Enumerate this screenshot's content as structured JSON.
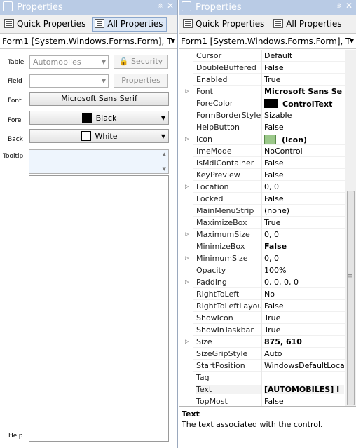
{
  "left_panel": {
    "title": "Properties",
    "toolbar": {
      "quick_label": "Quick Properties",
      "all_label": "All Properties",
      "active": "all"
    },
    "object_selector": "Form1 [System.Windows.Forms.Form], T",
    "fields": {
      "table_label": "Table",
      "table_value": "Automobiles",
      "security_label": "Security",
      "field_label": "Field",
      "field_value": "",
      "properties_label": "Properties",
      "font_label": "Font",
      "font_value": "Microsoft Sans Serif",
      "fore_label": "Fore",
      "fore_value": "Black",
      "fore_color": "#000000",
      "back_label": "Back",
      "back_value": "White",
      "back_color": "#ffffff",
      "tooltip_label": "Tooltip",
      "help_label": "Help"
    }
  },
  "right_panel": {
    "title": "Properties",
    "toolbar": {
      "quick_label": "Quick Properties",
      "all_label": "All Properties"
    },
    "object_selector": "Form1 [System.Windows.Forms.Form], T",
    "properties": [
      {
        "name": "Cursor",
        "value": "Default"
      },
      {
        "name": "DoubleBuffered",
        "value": "False"
      },
      {
        "name": "Enabled",
        "value": "True"
      },
      {
        "name": "Font",
        "value": "Microsoft Sans Se",
        "expandable": true,
        "bold": true
      },
      {
        "name": "ForeColor",
        "value": "ControlText",
        "swatch": "#000000",
        "bold": true
      },
      {
        "name": "FormBorderStyle",
        "value": "Sizable"
      },
      {
        "name": "HelpButton",
        "value": "False"
      },
      {
        "name": "Icon",
        "value": "(Icon)",
        "expandable": true,
        "bold": true,
        "icon": true
      },
      {
        "name": "ImeMode",
        "value": "NoControl"
      },
      {
        "name": "IsMdiContainer",
        "value": "False"
      },
      {
        "name": "KeyPreview",
        "value": "False"
      },
      {
        "name": "Location",
        "value": "0, 0",
        "expandable": true
      },
      {
        "name": "Locked",
        "value": "False"
      },
      {
        "name": "MainMenuStrip",
        "value": "(none)"
      },
      {
        "name": "MaximizeBox",
        "value": "True"
      },
      {
        "name": "MaximumSize",
        "value": "0, 0",
        "expandable": true
      },
      {
        "name": "MinimizeBox",
        "value": "False",
        "bold": true
      },
      {
        "name": "MinimumSize",
        "value": "0, 0",
        "expandable": true
      },
      {
        "name": "Opacity",
        "value": "100%"
      },
      {
        "name": "Padding",
        "value": "0, 0, 0, 0",
        "expandable": true
      },
      {
        "name": "RightToLeft",
        "value": "No"
      },
      {
        "name": "RightToLeftLayout",
        "value": "False"
      },
      {
        "name": "ShowIcon",
        "value": "True"
      },
      {
        "name": "ShowInTaskbar",
        "value": "True"
      },
      {
        "name": "Size",
        "value": "875, 610",
        "expandable": true,
        "bold": true
      },
      {
        "name": "SizeGripStyle",
        "value": "Auto"
      },
      {
        "name": "StartPosition",
        "value": "WindowsDefaultLocation"
      },
      {
        "name": "Tag",
        "value": ""
      },
      {
        "name": "Text",
        "value": "[AUTOMOBILES] I",
        "bold": true,
        "selected": true
      },
      {
        "name": "TopMost",
        "value": "False"
      }
    ],
    "description": {
      "title": "Text",
      "text": "The text associated with the control."
    }
  },
  "colors": {
    "titlebar": "#b9cbe5",
    "accent": "#8aa6cc",
    "tooltip_bg": "#eef5fd"
  },
  "icons": {
    "pin": "pin-icon",
    "close": "close-icon",
    "quick": "quick-properties-icon",
    "all": "all-properties-icon"
  }
}
